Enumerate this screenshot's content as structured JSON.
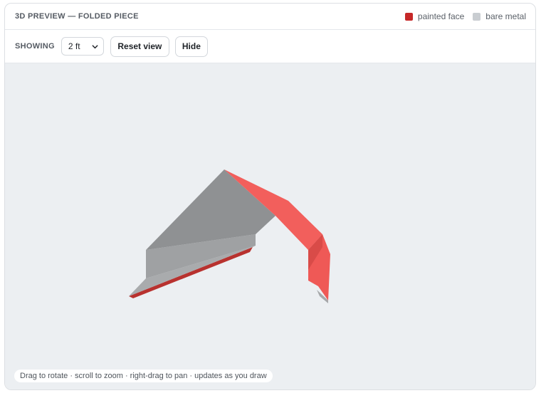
{
  "header": {
    "title": "3D PREVIEW — FOLDED PIECE",
    "legend": [
      {
        "label": "painted face",
        "color": "#c62828"
      },
      {
        "label": "bare metal",
        "color": "#c9cdd1"
      }
    ]
  },
  "toolbar": {
    "showing_label": "SHOWING",
    "length_select": {
      "value": "2 ft"
    },
    "reset_label": "Reset view",
    "hide_label": "Hide"
  },
  "viewport": {
    "hint": "Drag to rotate · scroll to zoom · right-drag to pan · updates as you draw",
    "colors": {
      "background": "#eceff2",
      "painted": "#f25f5c",
      "painted_dark": "#d94b48",
      "painted_edge": "#b8322f",
      "bare": "#8f9193",
      "bare_light": "#a6a8aa",
      "bare_edge": "#7a7d80"
    }
  }
}
